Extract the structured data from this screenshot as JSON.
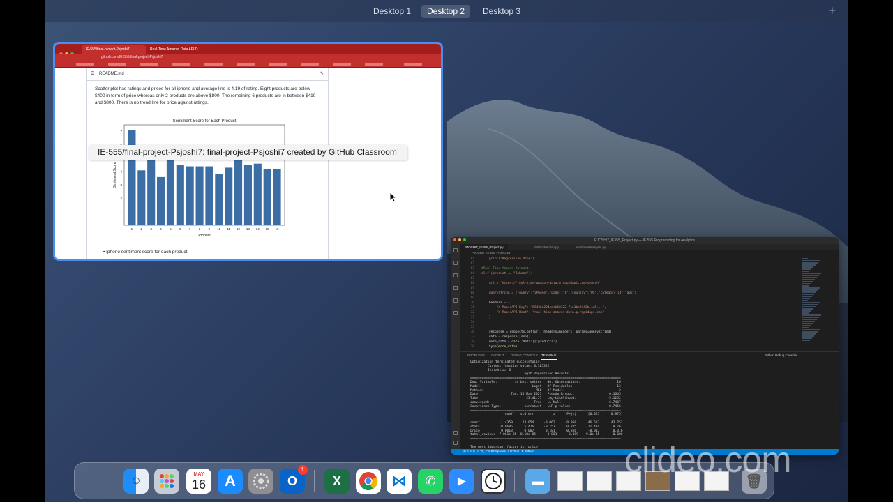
{
  "mission_control": {
    "desktops": [
      "Desktop 1",
      "Desktop 2",
      "Desktop 3"
    ],
    "active": "Desktop 2",
    "add_symbol": "+"
  },
  "browser": {
    "tabs": [
      "IE-555/final-project-Psjoshi7",
      "Real-Time Amazon Data API D"
    ],
    "url": "github.com/IE-555/final-project-Psjoshi7",
    "readme_title": "README.md",
    "paragraph": "Scatter plot has ratings and prices for all iphone and average line is 4.19 of rating. Eight products are below $400 in term of price whereas only 2 products are above $800. The remaining 6 products are in between $410 and $800. There is no trend line for price against ratings.",
    "bullet": "Iphone sentiment score for each product",
    "tooltip": "IE-555/final-project-Psjoshi7: final-project-Psjoshi7 created by GitHub Classroom"
  },
  "chart_data": {
    "type": "bar",
    "title": "Sentiment Score for Each Product",
    "xlabel": "Product",
    "ylabel": "Sentiment Score",
    "categories": [
      "1",
      "2",
      "3",
      "4",
      "5",
      "6",
      "7",
      "8",
      "9",
      "10",
      "11",
      "12",
      "13",
      "14",
      "15",
      "16"
    ],
    "values": [
      7.1,
      4.1,
      5.6,
      3.6,
      5.5,
      4.5,
      4.4,
      4.4,
      4.4,
      3.8,
      4.3,
      5.0,
      4.5,
      4.6,
      4.2,
      4.2
    ],
    "ylim": [
      0,
      7.5
    ],
    "yticks": [
      "1",
      "2",
      "3",
      "4",
      "5",
      "6",
      "7"
    ],
    "color": "#3a6ea5"
  },
  "vscode": {
    "title": "PJOSHI7_IE555_Project.py — IE 555 Programming for Analytics",
    "tabs": [
      "PJOSHI7_IE555_Project.py",
      "dataExtraction.py",
      "sentimentAnalysis.py"
    ],
    "breadcrumb": "PJOSHI7_IE555_Project.py",
    "code": [
      {
        "n": "61",
        "t": "    print(\"Regression Done\")"
      },
      {
        "n": "62",
        "t": ""
      },
      {
        "n": "63",
        "t": "#Real-Time Amazon Dataset"
      },
      {
        "n": "64",
        "t": "elif (product == \"Iphone\"):"
      },
      {
        "n": "65",
        "t": ""
      },
      {
        "n": "66",
        "t": "    url = \"https://real-time-amazon-data.p.rapidapi.com/search\""
      },
      {
        "n": "67",
        "t": ""
      },
      {
        "n": "68",
        "t": "    querystring = {\"query\":\"iPhone\",\"page\":\"1\",\"country\":\"US\",\"category_id\":\"aps\"}"
      },
      {
        "n": "69",
        "t": ""
      },
      {
        "n": "70",
        "t": "    headers = {"
      },
      {
        "n": "71",
        "t": "        \"X-RapidAPI-Key\": \"09436a224emsh60722 7ea1bc2f42bjsn5...\","
      },
      {
        "n": "72",
        "t": "        \"X-RapidAPI-Host\": \"real-time-amazon-data.p.rapidapi.com\""
      },
      {
        "n": "73",
        "t": "    }"
      },
      {
        "n": "74",
        "t": ""
      },
      {
        "n": "75",
        "t": ""
      },
      {
        "n": "76",
        "t": "    response = requests.get(url, headers=headers, params=querystring)"
      },
      {
        "n": "77",
        "t": "    data = response.json()"
      },
      {
        "n": "78",
        "t": "    more_data = data['data']['products']"
      },
      {
        "n": "79",
        "t": "    type(more_data)"
      }
    ],
    "panel_tabs": [
      "PROBLEMS",
      "OUTPUT",
      "DEBUG CONSOLE",
      "TERMINAL"
    ],
    "active_panel": "TERMINAL",
    "panel_right": "Python Debug Console",
    "terminal": [
      "Optimization terminated successfully.",
      "         Current function value: 0.385322",
      "         Iterations 8",
      "                           Logit Regression Results",
      "==============================================================================",
      "Dep. Variable:         is_best_seller   No. Observations:                   16",
      "Model:                          Logit   Df Residuals:                       13",
      "Method:                           MLE   Df Model:                            2",
      "Date:                Tue, 16 May 2023   Pseudo R-squ.:                  0.1645",
      "Time:                        23:41:57   Log-Likelihood:                -5.1252",
      "converged:                       True   LL-Null:                       -6.7407",
      "Covariance Type:            nonrobust   LLR p-value:                    0.7456",
      "==============================================================================",
      "                  coef    std err          z      P>|z|      [0.025      0.975]",
      "------------------------------------------------------------------------------",
      "const          -1.4359     23.054     -0.062      0.950     -46.617      43.753",
      "stars          -0.8685      5.416     -0.157      0.875     -11.484       9.767",
      "price           0.0013      0.007      0.181      0.856      -0.013       0.016",
      "total_reviews  7.061e-05  8.18e-05      0.861      0.389   -9.0e-05       0.000",
      "==============================================================================",
      "",
      "The most important factor is: price",
      "Regression Done",
      "(base) yateen@Yateens-MBP IE 555 Programming for Analytics % "
    ],
    "status": "⊗ 0 ⚠ 0   Ln 79, Col 83   Spaces: 4   UTF-8   LF   Python"
  },
  "dock": {
    "calendar_month": "MAY",
    "calendar_day": "16",
    "outlook_badge": "1"
  },
  "watermark": "clideo.com"
}
